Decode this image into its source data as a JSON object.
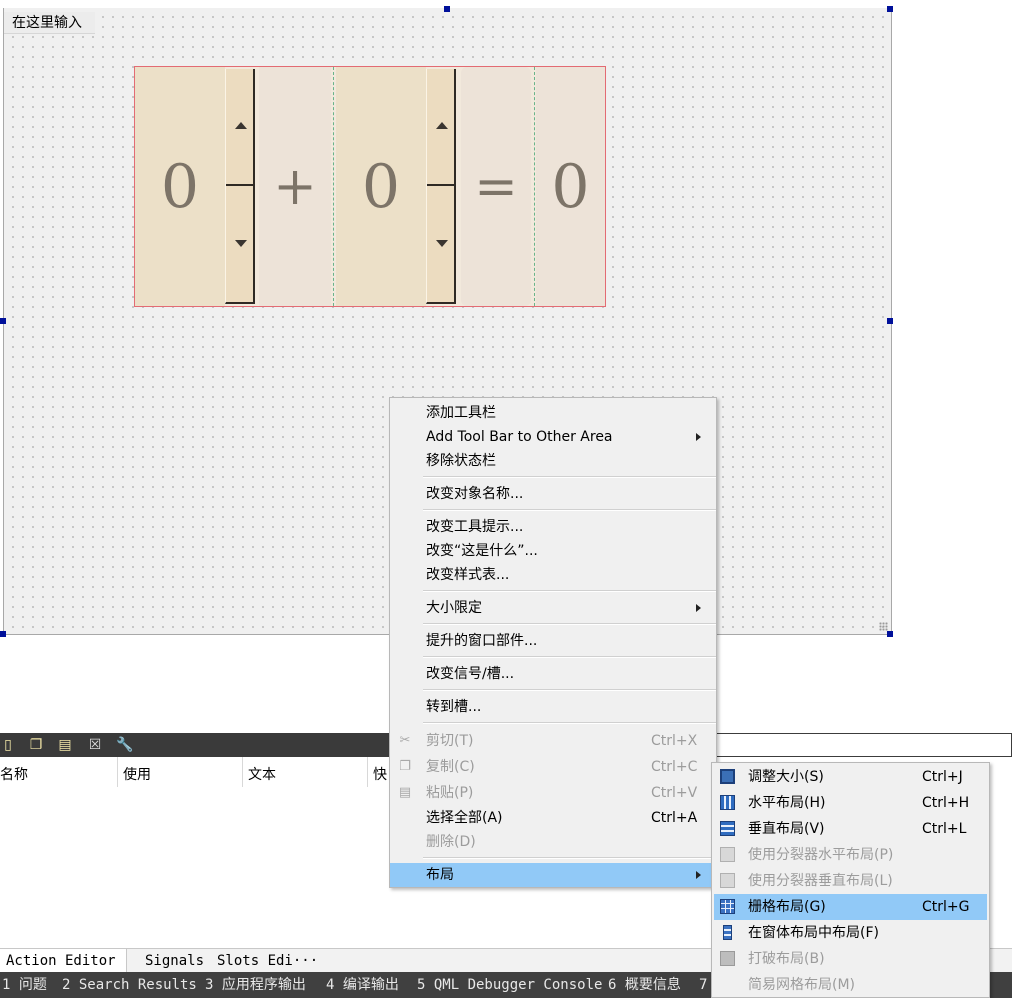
{
  "form": {
    "menubar_placeholder": "在这里输入"
  },
  "calculator": {
    "left_operand": "0",
    "operator": "+",
    "right_operand": "0",
    "equals": "=",
    "result": "0"
  },
  "action_editor": {
    "toolbar_icons": [
      "new-action-icon",
      "copy-icon",
      "paste-icon",
      "delete-icon",
      "wrench-icon"
    ],
    "columns": [
      "名称",
      "使用",
      "文本",
      "快"
    ]
  },
  "bottom_tabs": [
    "Action Editor",
    "Signals",
    "Slots Edi···"
  ],
  "status_bar": [
    "1 问题",
    "2 Search Results",
    "3 应用程序输出",
    "4 编译输出",
    "5 QML Debugger Console",
    "6 概要信息",
    "7"
  ],
  "context_menu": {
    "items": [
      {
        "label": "添加工具栏",
        "shortcut": "",
        "disabled": false,
        "submenu": false
      },
      {
        "label": "Add Tool Bar to Other Area",
        "shortcut": "",
        "disabled": false,
        "submenu": true
      },
      {
        "label": "移除状态栏",
        "shortcut": "",
        "disabled": false,
        "submenu": false
      },
      {
        "label": "改变对象名称...",
        "shortcut": "",
        "disabled": false,
        "submenu": false
      },
      {
        "label": "改变工具提示...",
        "shortcut": "",
        "disabled": false,
        "submenu": false
      },
      {
        "label": "改变“这是什么”...",
        "shortcut": "",
        "disabled": false,
        "submenu": false
      },
      {
        "label": "改变样式表...",
        "shortcut": "",
        "disabled": false,
        "submenu": false
      },
      {
        "label": "大小限定",
        "shortcut": "",
        "disabled": false,
        "submenu": true
      },
      {
        "label": "提升的窗口部件...",
        "shortcut": "",
        "disabled": false,
        "submenu": false
      },
      {
        "label": "改变信号/槽...",
        "shortcut": "",
        "disabled": false,
        "submenu": false
      },
      {
        "label": "转到槽...",
        "shortcut": "",
        "disabled": false,
        "submenu": false
      },
      {
        "label": "剪切(T)",
        "shortcut": "Ctrl+X",
        "disabled": true,
        "submenu": false
      },
      {
        "label": "复制(C)",
        "shortcut": "Ctrl+C",
        "disabled": true,
        "submenu": false
      },
      {
        "label": "粘贴(P)",
        "shortcut": "Ctrl+V",
        "disabled": true,
        "submenu": false
      },
      {
        "label": "选择全部(A)",
        "shortcut": "Ctrl+A",
        "disabled": false,
        "submenu": false
      },
      {
        "label": "删除(D)",
        "shortcut": "",
        "disabled": true,
        "submenu": false
      },
      {
        "label": "布局",
        "shortcut": "",
        "disabled": false,
        "submenu": true,
        "highlighted": true
      }
    ]
  },
  "layout_submenu": {
    "items": [
      {
        "label": "调整大小(S)",
        "shortcut": "Ctrl+J",
        "disabled": false,
        "icon": "adjust-size-icon"
      },
      {
        "label": "水平布局(H)",
        "shortcut": "Ctrl+H",
        "disabled": false,
        "icon": "horizontal-layout-icon"
      },
      {
        "label": "垂直布局(V)",
        "shortcut": "Ctrl+L",
        "disabled": false,
        "icon": "vertical-layout-icon"
      },
      {
        "label": "使用分裂器水平布局(P)",
        "shortcut": "",
        "disabled": true,
        "icon": "horizontal-splitter-icon"
      },
      {
        "label": "使用分裂器垂直布局(L)",
        "shortcut": "",
        "disabled": true,
        "icon": "vertical-splitter-icon"
      },
      {
        "label": "栅格布局(G)",
        "shortcut": "Ctrl+G",
        "disabled": false,
        "highlighted": true,
        "icon": "grid-layout-icon"
      },
      {
        "label": "在窗体布局中布局(F)",
        "shortcut": "",
        "disabled": false,
        "icon": "form-layout-icon"
      },
      {
        "label": "打破布局(B)",
        "shortcut": "",
        "disabled": true,
        "icon": "break-layout-icon"
      },
      {
        "label": "简易网格布局(M)",
        "shortcut": "",
        "disabled": true,
        "icon": ""
      }
    ]
  },
  "colors": {
    "selection_handle": "#00109a",
    "menu_highlight": "#91c9f7",
    "calc_background": "#f2e9dc",
    "status_bar": "#404040"
  }
}
